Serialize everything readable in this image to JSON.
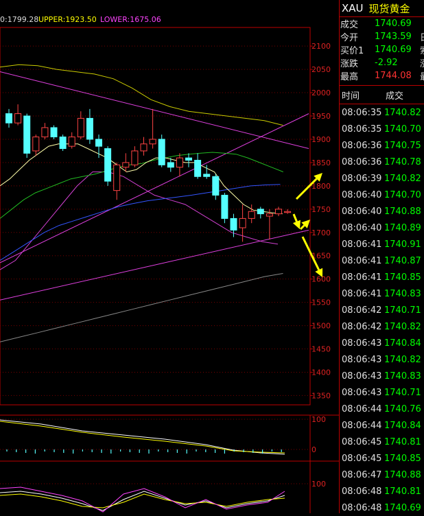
{
  "header": {
    "mid_label": "0:1799.28",
    "upper_label": "UPPER:1923.50",
    "lower_label": "LOWER:1675.06"
  },
  "y_axis_ticks": [
    "2100",
    "2050",
    "2000",
    "1950",
    "1900",
    "1850",
    "1800",
    "1750",
    "1700",
    "1650",
    "1600",
    "1550",
    "1500",
    "1450",
    "1400",
    "1350"
  ],
  "macd_ticks": [
    "100",
    "0"
  ],
  "kdj_ticks": [
    "100"
  ],
  "chart_data": {
    "type": "candlestick",
    "symbol": "XAU",
    "ylim": [
      1330,
      2140
    ],
    "candles": [
      {
        "o": 1955,
        "c": 1935,
        "h": 1965,
        "l": 1925
      },
      {
        "o": 1935,
        "c": 1955,
        "h": 1975,
        "l": 1930
      },
      {
        "o": 1950,
        "c": 1870,
        "h": 1955,
        "l": 1860
      },
      {
        "o": 1875,
        "c": 1905,
        "h": 1910,
        "l": 1865
      },
      {
        "o": 1905,
        "c": 1925,
        "h": 1935,
        "l": 1900
      },
      {
        "o": 1925,
        "c": 1905,
        "h": 1930,
        "l": 1900
      },
      {
        "o": 1905,
        "c": 1880,
        "h": 1910,
        "l": 1875
      },
      {
        "o": 1885,
        "c": 1905,
        "h": 1915,
        "l": 1880
      },
      {
        "o": 1905,
        "c": 1945,
        "h": 1960,
        "l": 1900
      },
      {
        "o": 1945,
        "c": 1900,
        "h": 1965,
        "l": 1890
      },
      {
        "o": 1900,
        "c": 1885,
        "h": 1910,
        "l": 1860
      },
      {
        "o": 1880,
        "c": 1810,
        "h": 1885,
        "l": 1800
      },
      {
        "o": 1790,
        "c": 1845,
        "h": 1850,
        "l": 1770
      },
      {
        "o": 1840,
        "c": 1850,
        "h": 1870,
        "l": 1830
      },
      {
        "o": 1845,
        "c": 1875,
        "h": 1885,
        "l": 1840
      },
      {
        "o": 1875,
        "c": 1890,
        "h": 1905,
        "l": 1865
      },
      {
        "o": 1890,
        "c": 1900,
        "h": 1965,
        "l": 1880
      },
      {
        "o": 1900,
        "c": 1845,
        "h": 1910,
        "l": 1840
      },
      {
        "o": 1850,
        "c": 1840,
        "h": 1860,
        "l": 1830
      },
      {
        "o": 1840,
        "c": 1860,
        "h": 1870,
        "l": 1820
      },
      {
        "o": 1860,
        "c": 1855,
        "h": 1870,
        "l": 1840
      },
      {
        "o": 1855,
        "c": 1820,
        "h": 1870,
        "l": 1815
      },
      {
        "o": 1825,
        "c": 1820,
        "h": 1845,
        "l": 1815
      },
      {
        "o": 1820,
        "c": 1780,
        "h": 1825,
        "l": 1770
      },
      {
        "o": 1780,
        "c": 1730,
        "h": 1785,
        "l": 1720
      },
      {
        "o": 1730,
        "c": 1705,
        "h": 1740,
        "l": 1690
      },
      {
        "o": 1710,
        "c": 1730,
        "h": 1760,
        "l": 1680
      },
      {
        "o": 1730,
        "c": 1745,
        "h": 1760,
        "l": 1720
      },
      {
        "o": 1750,
        "c": 1740,
        "h": 1755,
        "l": 1730
      },
      {
        "o": 1735,
        "c": 1740,
        "h": 1750,
        "l": 1685
      },
      {
        "o": 1740,
        "c": 1750,
        "h": 1755,
        "l": 1735
      },
      {
        "o": 1745,
        "c": 1745,
        "h": 1750,
        "l": 1740
      }
    ],
    "candle_x0": -1,
    "candle_dx": 13.1,
    "ma_yellow": [
      1800,
      1815,
      1835,
      1855,
      1870,
      1885,
      1890,
      1890,
      1890,
      1880,
      1870,
      1860,
      1845,
      1830,
      1835,
      1850,
      1860,
      1860,
      1855,
      1850,
      1850,
      1840,
      1830,
      1800,
      1780,
      1760,
      1748,
      1745,
      1742,
      1740
    ],
    "ma_green": [
      1730,
      1750,
      1770,
      1785,
      1795,
      1805,
      1815,
      1820,
      1825,
      1832,
      1840,
      1845,
      1848,
      1855,
      1860,
      1865,
      1868,
      1870,
      1872,
      1870,
      1868,
      1860,
      1850,
      1840,
      1830
    ],
    "ma_blue": [
      1640,
      1660,
      1680,
      1700,
      1715,
      1725,
      1735,
      1745,
      1755,
      1762,
      1768,
      1772,
      1776,
      1780,
      1785,
      1790,
      1795,
      1800,
      1802,
      1803
    ],
    "ma_gray": [
      1465,
      1475,
      1485,
      1495,
      1505,
      1515,
      1525,
      1535,
      1545,
      1555,
      1565,
      1575,
      1585,
      1595,
      1605,
      1612
    ],
    "boll_upper": [
      2055,
      2060,
      2058,
      2050,
      2045,
      2040,
      2030,
      2010,
      1985,
      1970,
      1960,
      1955,
      1950,
      1945,
      1940,
      1930
    ],
    "boll_lower": [
      1620,
      1640,
      1680,
      1720,
      1760,
      1800,
      1830,
      1830,
      1820,
      1800,
      1780,
      1770,
      1760,
      1740,
      1720,
      1700,
      1690,
      1680,
      1675
    ],
    "arrows": [
      {
        "from": [
          1745,
          430
        ],
        "to": [
          1840,
          470
        ]
      },
      {
        "from": [
          1735,
          428
        ],
        "to": [
          1705,
          437
        ]
      },
      {
        "from": [
          1720,
          428
        ],
        "to": [
          1745,
          452
        ]
      },
      {
        "from": [
          1690,
          440
        ],
        "to": [
          1610,
          470
        ]
      }
    ]
  },
  "sidebar": {
    "symbol": "XAU",
    "name": "现货黄金",
    "quote_rows": [
      {
        "label": "成交",
        "value": "1740.69",
        "color": "#00ff00",
        "edge": ""
      },
      {
        "label": "今开",
        "value": "1743.59",
        "color": "#00ff00",
        "edge": "日"
      },
      {
        "label": "买价1",
        "value": "1740.69",
        "color": "#00ff00",
        "edge": "索"
      },
      {
        "label": "涨跌",
        "value": "-2.92",
        "color": "#00ff00",
        "edge": "涨"
      },
      {
        "label": "最高",
        "value": "1744.08",
        "color": "#ff3333",
        "edge": "最"
      }
    ],
    "trade_header": {
      "time": "时间",
      "price": "成交"
    },
    "trades": [
      {
        "time": "08:06:35",
        "price": "1740.82"
      },
      {
        "time": "08:06:35",
        "price": "1740.70"
      },
      {
        "time": "08:06:36",
        "price": "1740.75"
      },
      {
        "time": "08:06:36",
        "price": "1740.78"
      },
      {
        "time": "08:06:39",
        "price": "1740.82"
      },
      {
        "time": "08:06:40",
        "price": "1740.70"
      },
      {
        "time": "08:06:40",
        "price": "1740.88"
      },
      {
        "time": "08:06:40",
        "price": "1740.89"
      },
      {
        "time": "08:06:41",
        "price": "1740.91"
      },
      {
        "time": "08:06:41",
        "price": "1740.87"
      },
      {
        "time": "08:06:41",
        "price": "1740.85"
      },
      {
        "time": "08:06:41",
        "price": "1740.83"
      },
      {
        "time": "08:06:42",
        "price": "1740.71"
      },
      {
        "time": "08:06:42",
        "price": "1740.82"
      },
      {
        "time": "08:06:43",
        "price": "1740.84"
      },
      {
        "time": "08:06:43",
        "price": "1740.82"
      },
      {
        "time": "08:06:43",
        "price": "1740.83"
      },
      {
        "time": "08:06:43",
        "price": "1740.71"
      },
      {
        "time": "08:06:44",
        "price": "1740.76"
      },
      {
        "time": "08:06:44",
        "price": "1740.84"
      },
      {
        "time": "08:06:45",
        "price": "1740.81"
      },
      {
        "time": "08:06:45",
        "price": "1740.85"
      },
      {
        "time": "08:06:47",
        "price": "1740.88"
      },
      {
        "time": "08:06:48",
        "price": "1740.81"
      },
      {
        "time": "08:06:48",
        "price": "1740.69"
      }
    ]
  }
}
